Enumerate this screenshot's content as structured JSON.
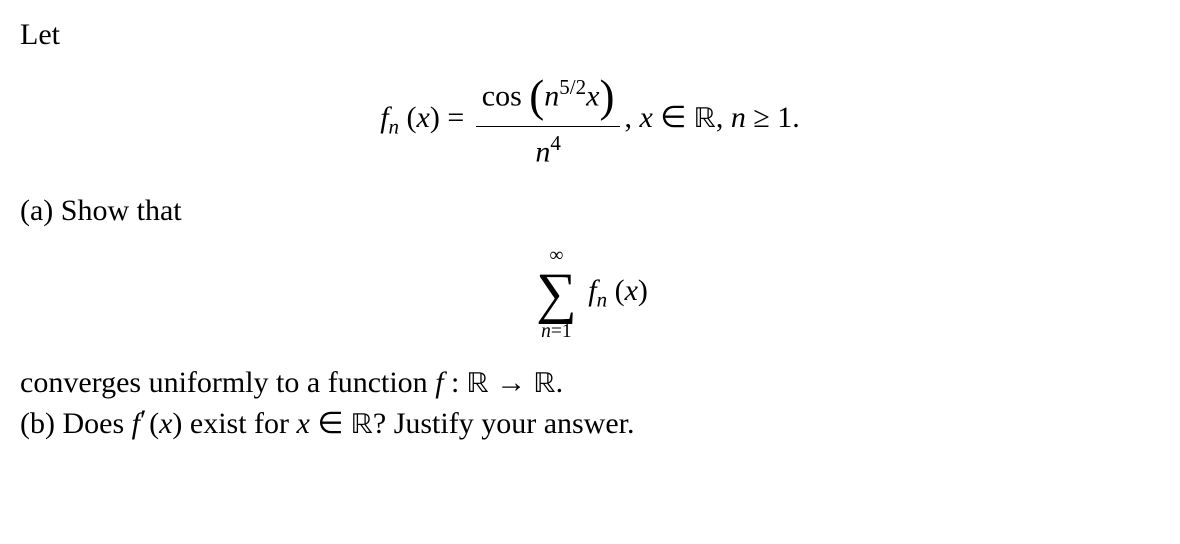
{
  "problem": {
    "intro": "Let",
    "fn_def": {
      "lhs_f": "f",
      "lhs_sub": "n",
      "lhs_arg_l": "(",
      "lhs_arg_var": "x",
      "lhs_arg_r": ")",
      "eq": " = ",
      "cos": "cos ",
      "bigl": "(",
      "num_n": "n",
      "num_exp": "5/2",
      "num_x": "x",
      "bigr": ")",
      "den_n": "n",
      "den_exp": "4",
      "tail_comma": ", ",
      "tail_x": "x",
      "tail_in": " ∈ ",
      "tail_R": "ℝ",
      "tail_comma2": ", ",
      "tail_n": "n",
      "tail_geq": " ≥ 1."
    },
    "part_a": {
      "label": "(a) Show that",
      "sum_top": "∞",
      "sum_bot_n": "n",
      "sum_bot_eq": "=1",
      "term_f": "f",
      "term_sub": "n",
      "term_l": "(",
      "term_x": "x",
      "term_r": ")",
      "after": "converges uniformly to a function ",
      "after_f": "f",
      "after_colon": " : ",
      "after_R1": "ℝ",
      "after_arrow": " → ",
      "after_R2": "ℝ",
      "after_period": "."
    },
    "part_b": {
      "pre": "(b) Does ",
      "f": "f",
      "prime": "′",
      "l": "(",
      "x": "x",
      "r": ")",
      "mid": " exist for ",
      "x2": "x",
      "in": " ∈ ",
      "R": "ℝ",
      "q": "? Justify your answer."
    }
  }
}
